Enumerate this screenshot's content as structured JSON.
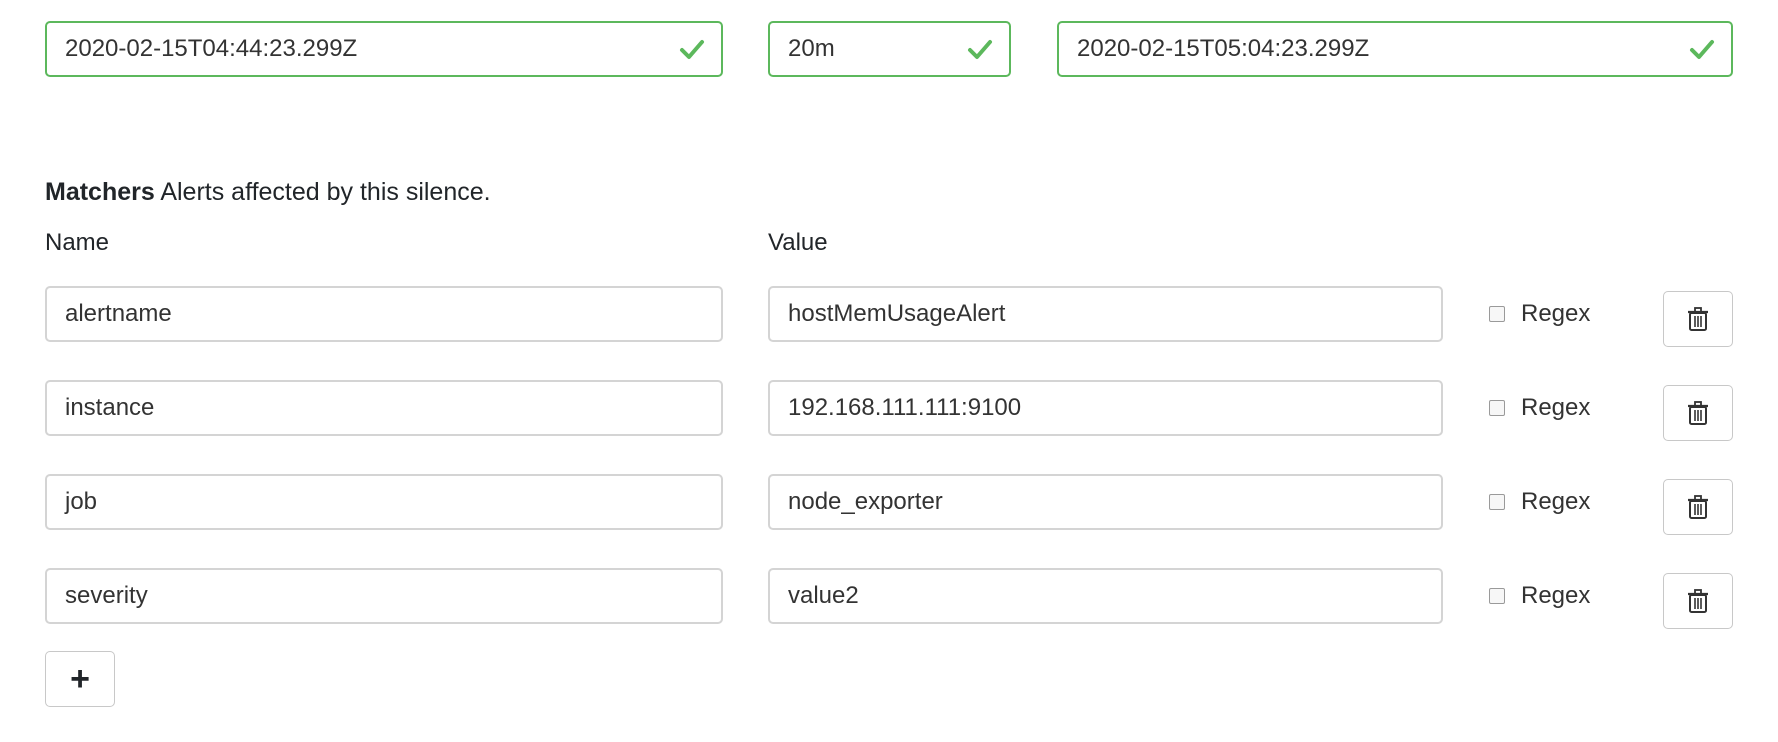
{
  "time": {
    "start": "2020-02-15T04:44:23.299Z",
    "duration": "20m",
    "end": "2020-02-15T05:04:23.299Z"
  },
  "matchers": {
    "title_bold": "Matchers",
    "title_rest": " Alerts affected by this silence.",
    "name_header": "Name",
    "value_header": "Value",
    "regex_label": "Regex",
    "rows": [
      {
        "name": "alertname",
        "value": "hostMemUsageAlert",
        "regex": false
      },
      {
        "name": "instance",
        "value": "192.168.111.111:9100",
        "regex": false
      },
      {
        "name": "job",
        "value": "node_exporter",
        "regex": false
      },
      {
        "name": "severity",
        "value": "value2",
        "regex": false
      }
    ],
    "add_label": "+"
  },
  "colors": {
    "valid": "#5cb85c",
    "border": "#d4d4d4"
  },
  "icons": {
    "valid": "check-icon",
    "delete": "trash-icon"
  }
}
